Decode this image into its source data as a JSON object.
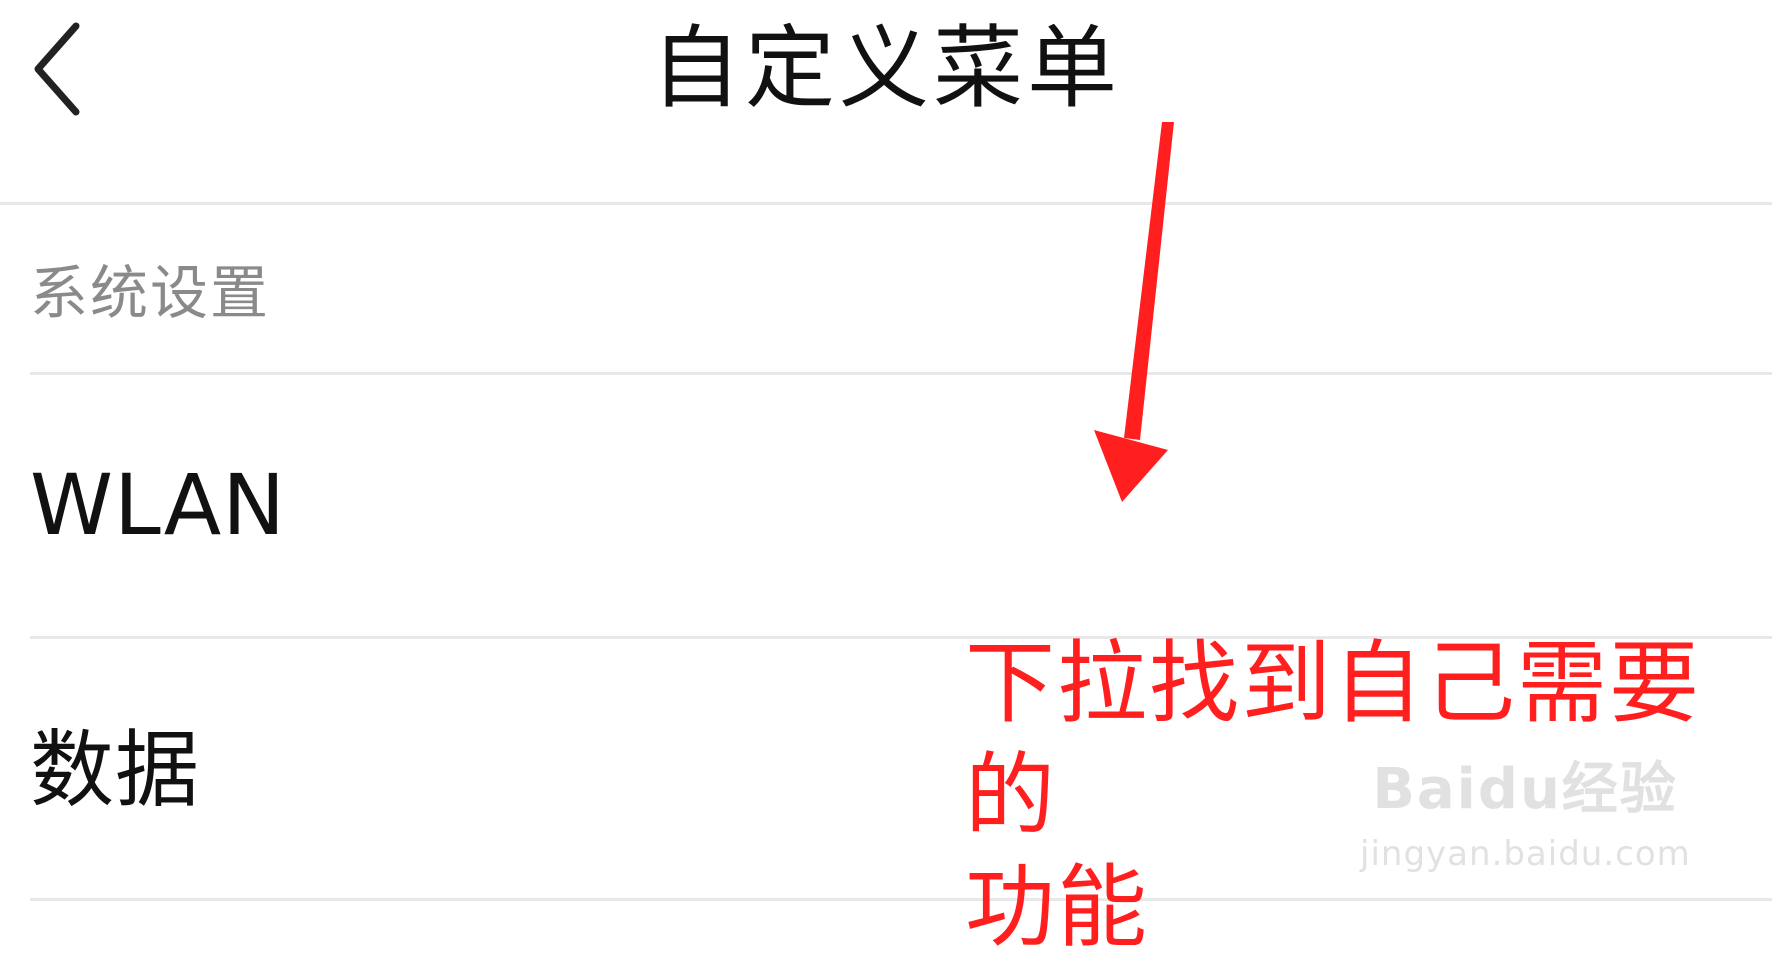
{
  "header": {
    "title": "自定义菜单",
    "back_icon": "chevron-left-icon"
  },
  "section": {
    "title": "系统设置"
  },
  "items": [
    {
      "label": "WLAN"
    },
    {
      "label": "数据"
    }
  ],
  "annotation": {
    "text_line1": "下拉找到自己需要的",
    "text_line2": "功能",
    "color": "#ff1f1f",
    "arrow_icon": "arrow-down-icon"
  },
  "watermark": {
    "logo": "Baidu经验",
    "url": "jingyan.baidu.com"
  },
  "colors": {
    "background": "#ffffff",
    "text": "#111111",
    "section_text": "#8a8a8a",
    "divider": "#e8e8e8"
  }
}
